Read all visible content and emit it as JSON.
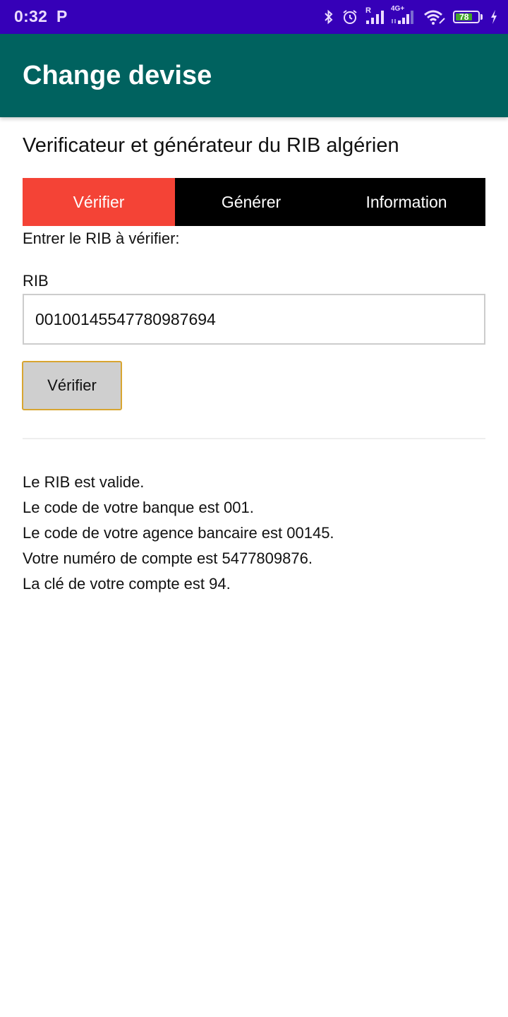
{
  "status_bar": {
    "time": "0:32",
    "notification_icon": "P",
    "network_r_label": "R",
    "network_label": "4G+",
    "battery_level": "78",
    "battery_percent": 78,
    "icons": [
      "bluetooth-icon",
      "alarm-icon",
      "signal-roaming-icon",
      "signal-4g-icon",
      "wifi-icon",
      "battery-icon",
      "charging-icon"
    ]
  },
  "app_bar": {
    "title": "Change devise"
  },
  "page": {
    "heading": "Verificateur et générateur du RIB algérien"
  },
  "tabs": [
    {
      "label": "Vérifier",
      "active": true
    },
    {
      "label": "Générer",
      "active": false
    },
    {
      "label": "Information",
      "active": false
    }
  ],
  "form": {
    "prompt": "Entrer le RIB à vérifier:",
    "rib_label": "RIB",
    "rib_value": "00100145547780987694",
    "verify_button": "Vérifier"
  },
  "results": {
    "lines": [
      "Le RIB est valide.",
      "Le code de votre banque est 001.",
      "Le code de votre agence bancaire est 00145.",
      "Votre numéro de compte est 5477809876.",
      "La clé de votre compte est 94."
    ]
  },
  "colors": {
    "status_bar": "#3600b8",
    "app_bar": "#00625f",
    "active_tab": "#f44336",
    "tab_bar": "#000000",
    "button_bg": "#cfcfcf",
    "button_border": "#d8a531",
    "battery_fill": "#43a52a"
  }
}
